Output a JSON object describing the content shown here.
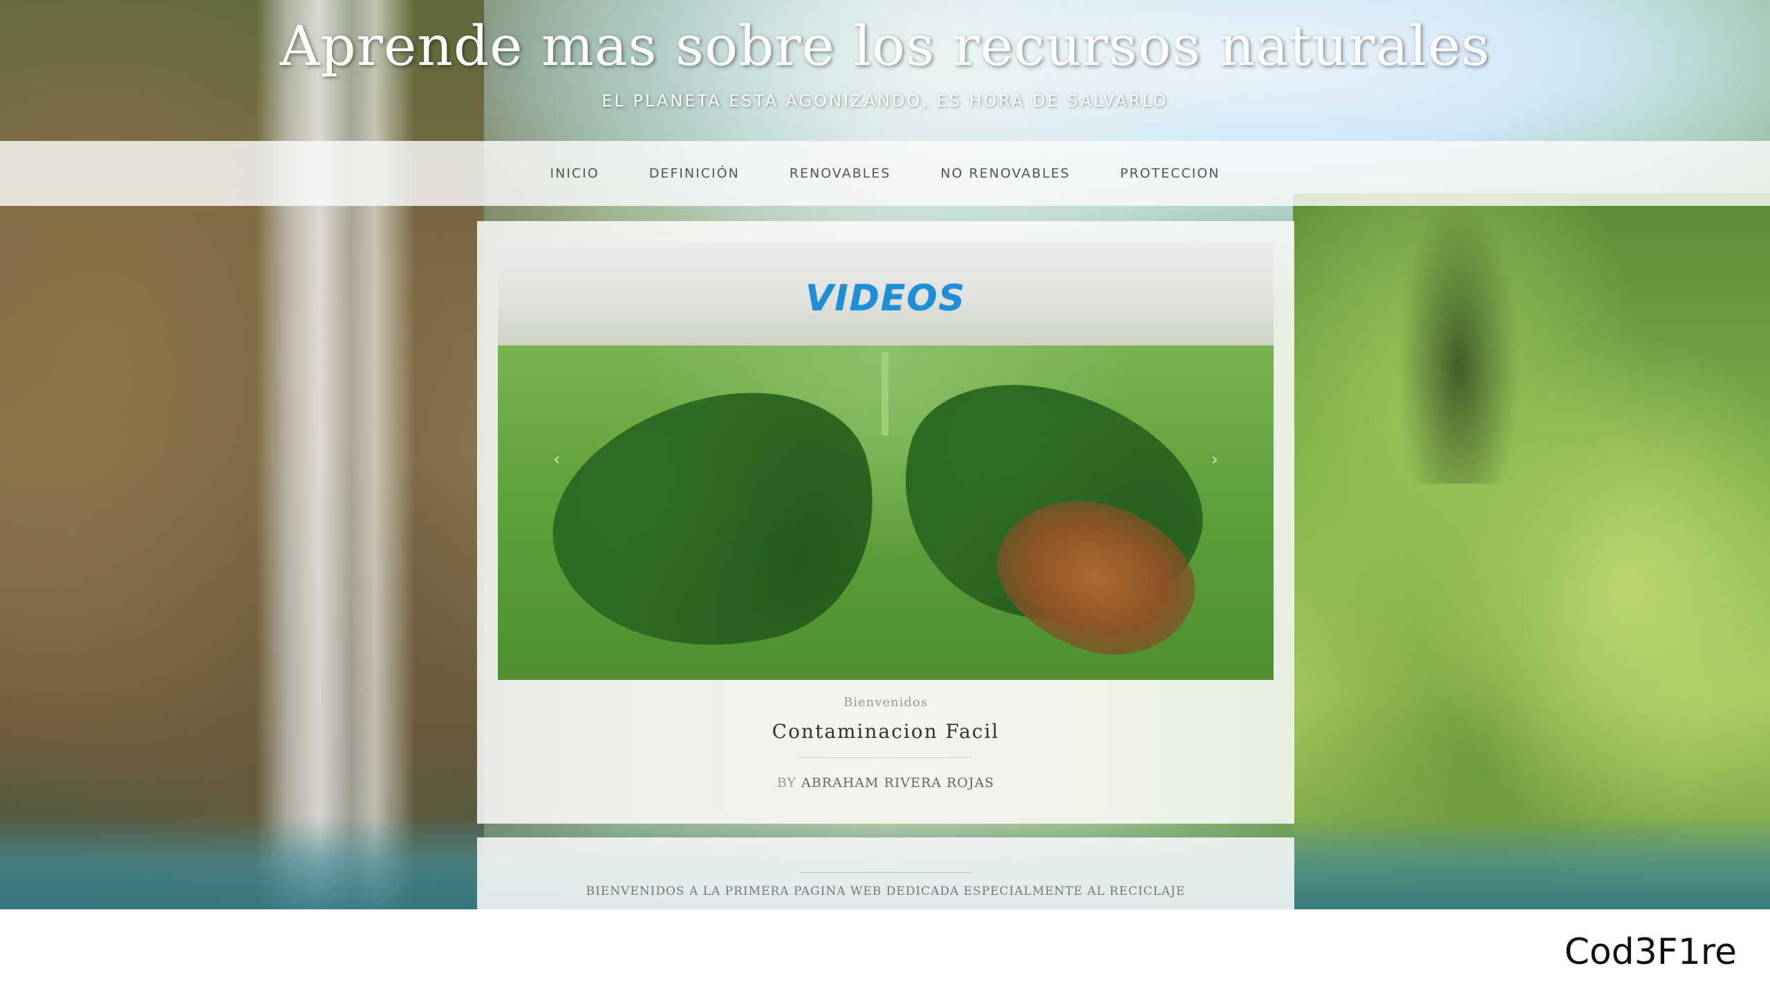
{
  "header": {
    "title": "Aprende mas sobre los recursos naturales",
    "tagline": "EL PLANETA ESTA AGONIZANDO, ES HORA DE SALVARLO"
  },
  "nav": {
    "items": [
      {
        "label": "INICIO"
      },
      {
        "label": "DEFINICIÓN"
      },
      {
        "label": "RENOVABLES"
      },
      {
        "label": "NO RENOVABLES"
      },
      {
        "label": "PROTECCION"
      }
    ]
  },
  "post": {
    "slider_logo": "VIDEOS",
    "prev_arrow": "‹",
    "next_arrow": "›",
    "category": "Bienvenidos",
    "title": "Contaminacion Facil",
    "byline_prefix": "BY",
    "author": "ABRAHAM RIVERA ROJAS"
  },
  "welcome": {
    "text": "BIENVENIDOS A LA PRIMERA PAGINA WEB DEDICADA ESPECIALMENTE AL RECICLAJE"
  },
  "watermark": {
    "text": "Cod3F1re"
  },
  "colors": {
    "videos_logo": "#1b8fd8",
    "nav_background": "#fafafa",
    "nav_text": "#555555"
  }
}
